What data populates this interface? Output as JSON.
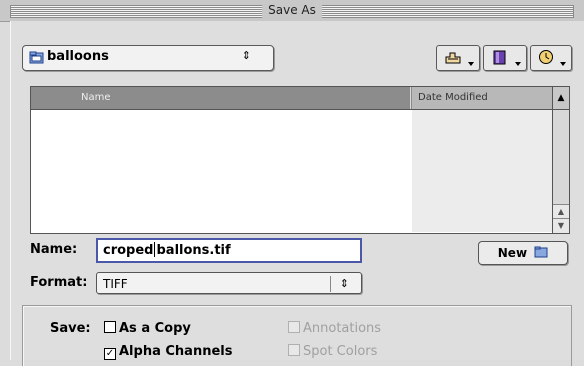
{
  "window": {
    "title": "Save As"
  },
  "folder_popup": {
    "label": "balloons",
    "arrows": "⇕",
    "icon": "folder-icon"
  },
  "toolbar": {
    "buttons": [
      {
        "name": "shortcuts-button",
        "icon": "hand-icon"
      },
      {
        "name": "favorites-button",
        "icon": "book-icon"
      },
      {
        "name": "recent-button",
        "icon": "clock-icon"
      }
    ]
  },
  "file_list": {
    "columns": {
      "name": "Name",
      "date": "Date Modified"
    },
    "sort_glyph": "▲",
    "items": []
  },
  "name_field": {
    "label": "Name:",
    "value_before": "croped",
    "value_after": "ballons.tif"
  },
  "new_button": {
    "label": "New"
  },
  "format": {
    "label": "Format:",
    "value": "TIFF",
    "arrows": "⇕"
  },
  "save_options": {
    "label": "Save:",
    "as_a_copy": {
      "label": "As a Copy",
      "checked": false
    },
    "alpha_channels": {
      "label": "Alpha Channels",
      "checked": true
    },
    "annotations": {
      "label": "Annotations",
      "checked": false,
      "enabled": false
    },
    "spot_colors": {
      "label": "Spot Colors",
      "checked": false,
      "enabled": false
    }
  },
  "colors": {
    "name_focus_border": "#4b57a8",
    "header_bg": "#8c8c8c"
  }
}
